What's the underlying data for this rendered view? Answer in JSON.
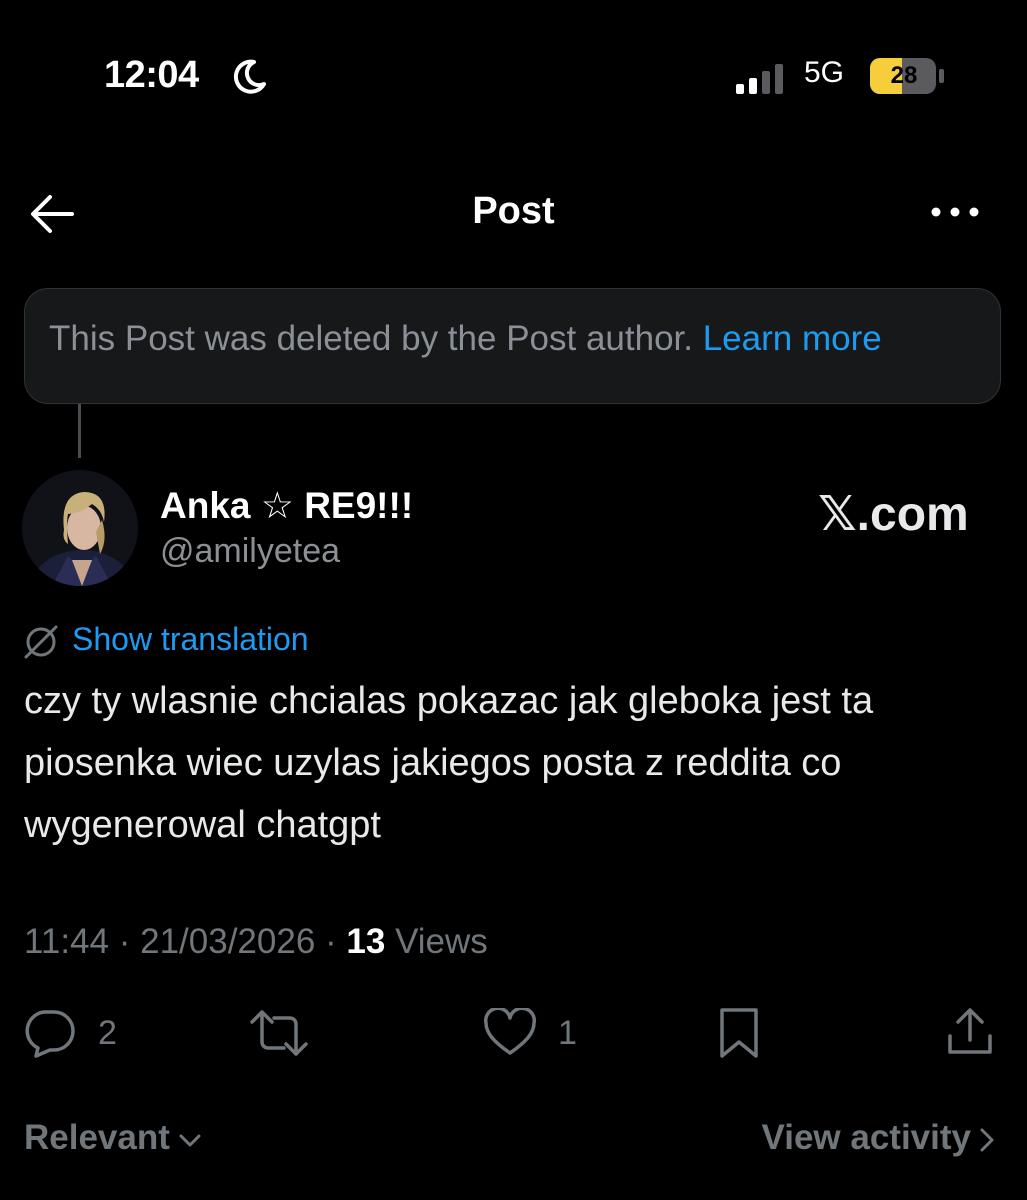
{
  "status_bar": {
    "time": "12:04",
    "network": "5G",
    "battery": "28",
    "battery_color": "#f6cd3b"
  },
  "header": {
    "title": "Post",
    "back_icon": "arrow-left-icon",
    "more_icon": "more-horizontal-icon"
  },
  "deleted_banner": {
    "text": "This Post was deleted by the Post author.",
    "link": "Learn more"
  },
  "author": {
    "name": "Anka ☆ RE9!!!",
    "handle": "@amilyetea"
  },
  "watermark": "𝕏.com",
  "post": {
    "translation_label": "Show translation",
    "text": "czy ty wlasnie chcialas pokazac jak gleboka jest ta piosenka wiec uzylas jakiegos posta z reddita co wygenerowal chatgpt",
    "time": "11:44",
    "date": "21/03/2026",
    "views_count": "13",
    "views_label": "Views"
  },
  "actions": {
    "replies": "2",
    "likes": "1"
  },
  "footer": {
    "sort_label": "Relevant",
    "activity_label": "View activity"
  },
  "colors": {
    "accent": "#1d9bf0",
    "muted": "#71767b",
    "background": "#000000"
  }
}
